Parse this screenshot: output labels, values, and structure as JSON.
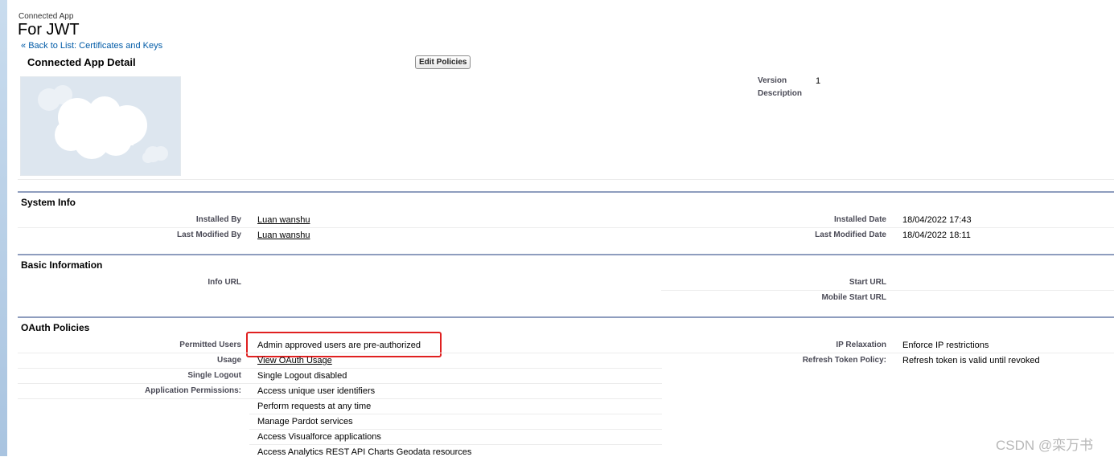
{
  "header": {
    "type_label": "Connected App",
    "title": "For JWT",
    "back_arrow": "«",
    "back_link": "Back to List: Certificates and Keys"
  },
  "detail": {
    "section_title": "Connected App Detail",
    "edit_button": "Edit Policies",
    "version_label": "Version",
    "version_value": "1",
    "description_label": "Description"
  },
  "system_info": {
    "title": "System Info",
    "installed_by_label": "Installed By",
    "installed_by_value": "Luan wanshu",
    "last_modified_by_label": "Last Modified By",
    "last_modified_by_value": "Luan wanshu",
    "installed_date_label": "Installed Date",
    "installed_date_value": "18/04/2022 17:43",
    "last_modified_date_label": "Last Modified Date",
    "last_modified_date_value": "18/04/2022 18:11"
  },
  "basic_info": {
    "title": "Basic Information",
    "info_url_label": "Info URL",
    "start_url_label": "Start URL",
    "mobile_start_url_label": "Mobile Start URL"
  },
  "oauth": {
    "title": "OAuth Policies",
    "permitted_users_label": "Permitted Users",
    "permitted_users_value": "Admin approved users are pre-authorized",
    "usage_label": "Usage",
    "usage_value": "View OAuth Usage",
    "single_logout_label": "Single Logout",
    "single_logout_value": "Single Logout disabled",
    "app_permissions_label": "Application Permissions:",
    "app_permissions": [
      "Access unique user identifiers",
      "Perform requests at any time",
      "Manage Pardot services",
      "Access Visualforce applications",
      "Access Analytics REST API Charts Geodata resources"
    ],
    "ip_relaxation_label": "IP Relaxation",
    "ip_relaxation_value": "Enforce IP restrictions",
    "refresh_token_label": "Refresh Token Policy:",
    "refresh_token_value": "Refresh token is valid until revoked"
  },
  "watermark": "CSDN @栾万书",
  "colors": {
    "link_blue": "#015ba7",
    "section_bar": "#8e9dbe",
    "highlight_red": "#e02020",
    "logo_bg": "#dde6ef"
  }
}
